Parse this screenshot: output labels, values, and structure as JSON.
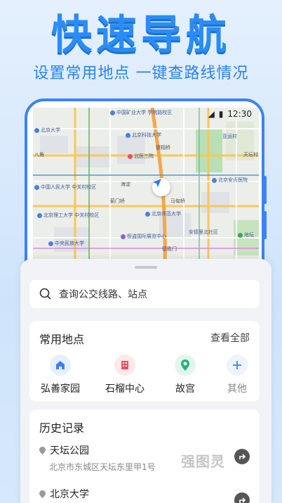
{
  "hero": {
    "title": "快速导航",
    "subtitle": "设置常用地点 一键查路线情况"
  },
  "status_bar": {
    "time": "12:30"
  },
  "map": {
    "pois": [
      {
        "name": "中国矿业大学\n学院路校区",
        "type": "blue"
      },
      {
        "name": "北京大学",
        "type": "blue"
      },
      {
        "name": "北京科技大学",
        "type": "blue"
      },
      {
        "name": "北医三院",
        "type": "red"
      },
      {
        "name": "中国人民大学\n中关村校区",
        "type": "blue"
      },
      {
        "name": "北京理工大学\n中关村校区",
        "type": "blue"
      },
      {
        "name": "北京师范大学",
        "type": "blue"
      },
      {
        "name": "北京安贞医院",
        "type": "blue"
      },
      {
        "name": "极盗国际展览中心",
        "type": "purple"
      },
      {
        "name": "中央民族大学",
        "type": "blue"
      },
      {
        "name": "安德里北社区",
        "type": "plain"
      },
      {
        "name": "地坛",
        "type": "green"
      },
      {
        "name": "亚运村",
        "type": "plain"
      }
    ],
    "road_labels": [
      "健翔桥",
      "马甸桥",
      "蓟门桥",
      "德胜门",
      "海淀",
      "八角",
      "天坛村"
    ]
  },
  "search": {
    "placeholder": "查询公交线路、站点"
  },
  "favorites": {
    "title": "常用地点",
    "see_all": "查看全部",
    "items": [
      {
        "label": "弘善家园",
        "icon": "home-icon",
        "color": "#3b7ff5"
      },
      {
        "label": "石榴中心",
        "icon": "building-icon",
        "color": "#f0505a"
      },
      {
        "label": "故宫",
        "icon": "location-pin-icon",
        "color": "#26b27a"
      },
      {
        "label": "其他",
        "icon": "plus-icon",
        "color": "#4a8df5"
      }
    ]
  },
  "history": {
    "title": "历史记录",
    "items": [
      {
        "name": "天坛公园",
        "address": "北京市东城区天坛东里甲1号"
      },
      {
        "name": "北京大学",
        "address": ""
      }
    ]
  },
  "watermark": "强图灵"
}
